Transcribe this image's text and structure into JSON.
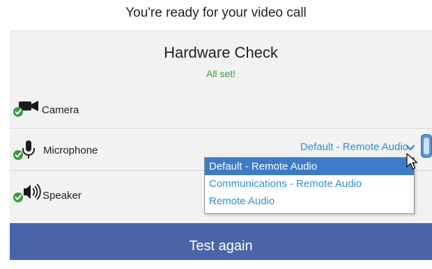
{
  "page": {
    "title": "You're ready for your video call"
  },
  "hardware_check": {
    "title": "Hardware Check",
    "status": "All set!",
    "status_color": "#3a9a3a"
  },
  "devices": [
    {
      "name": "camera",
      "label": "Camera",
      "icon": "camera-icon",
      "status_icon": "check-icon"
    },
    {
      "name": "microphone",
      "label": "Microphone",
      "icon": "microphone-icon",
      "status_icon": "check-icon"
    },
    {
      "name": "speaker",
      "label": "Speaker",
      "icon": "speaker-icon",
      "status_icon": "check-icon"
    }
  ],
  "microphone_select": {
    "selected": "Default - Remote Audio",
    "options": [
      "Default - Remote Audio",
      "Communications - Remote Audio",
      "Remote Audio"
    ],
    "highlighted_index": 0,
    "accent_color": "#2f8fd6"
  },
  "actions": {
    "test_again_label": "Test again",
    "button_color": "#4a64a8"
  }
}
